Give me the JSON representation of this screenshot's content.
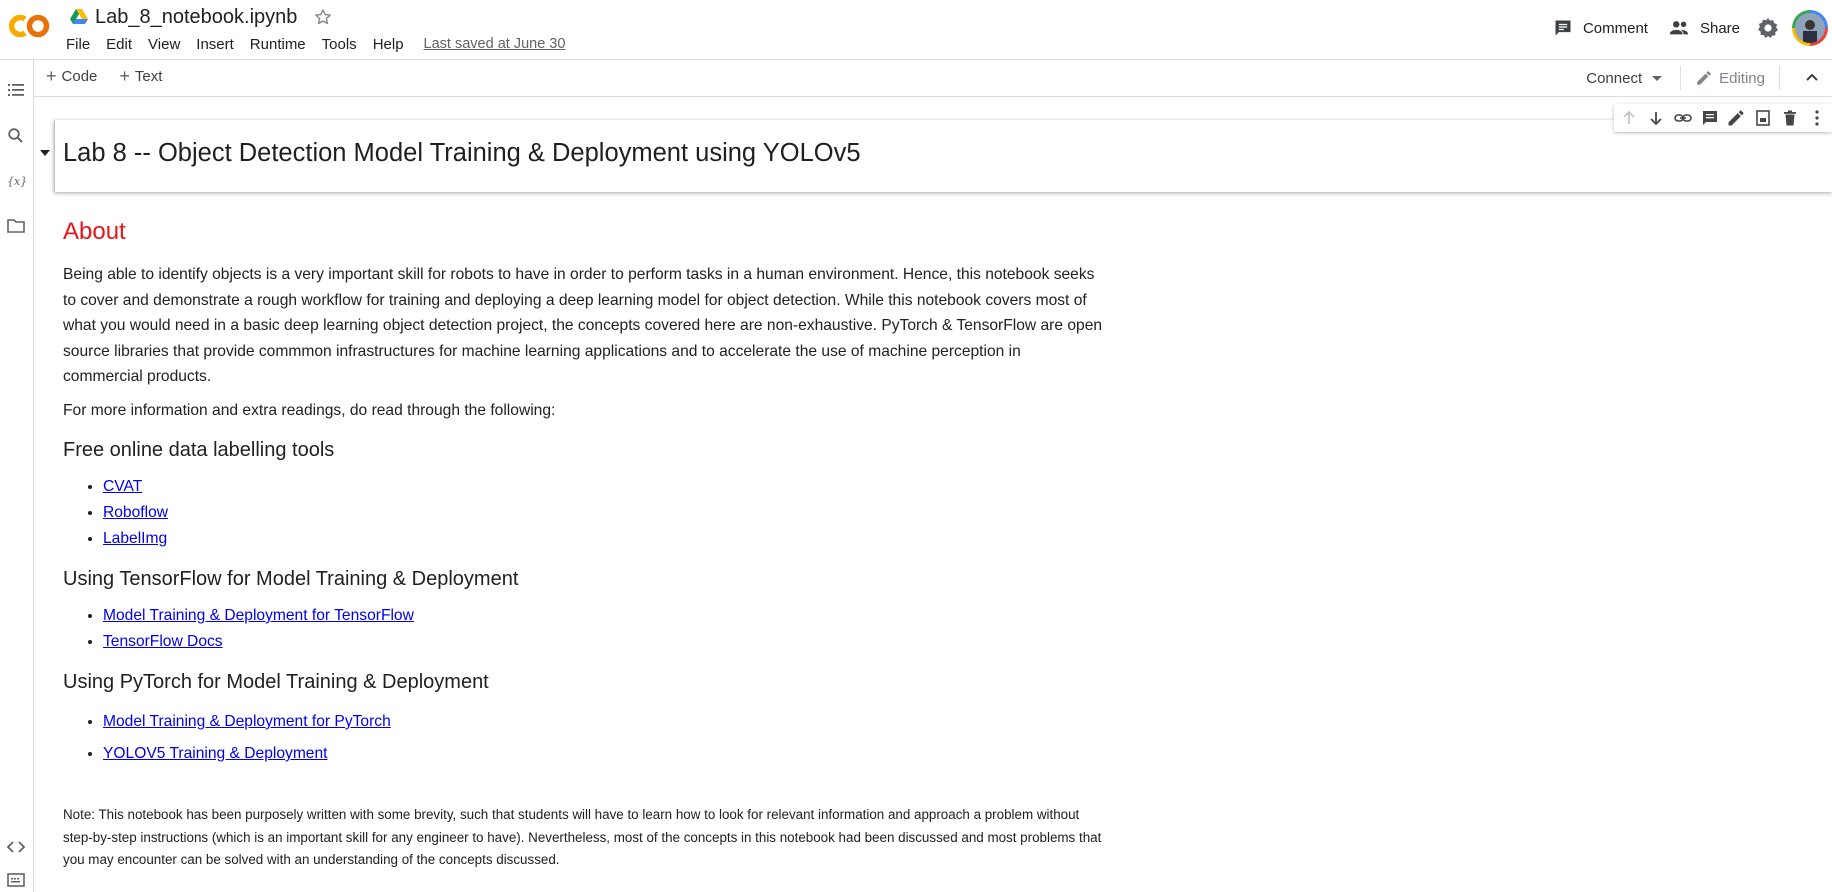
{
  "header": {
    "doc_title": "Lab_8_notebook.ipynb",
    "menu": [
      "File",
      "Edit",
      "View",
      "Insert",
      "Runtime",
      "Tools",
      "Help"
    ],
    "last_saved": "Last saved at June 30",
    "comment_label": "Comment",
    "share_label": "Share"
  },
  "toolbar": {
    "add_code": "Code",
    "add_text": "Text",
    "connect_label": "Connect",
    "editing_label": "Editing"
  },
  "cell": {
    "title": "Lab 8 -- Object Detection Model Training & Deployment using YOLOv5"
  },
  "content": {
    "about_heading": "About",
    "intro": "Being able to identify objects is a very important skill for robots to have in order to perform tasks in a human environment. Hence, this notebook seeks to cover and demonstrate a rough workflow for training and deploying a deep learning model for object detection. While this notebook covers most of what you would need in a basic deep learning object detection project, the concepts covered here are non-exhaustive. PyTorch & TensorFlow are open source libraries that provide commmon infrastructures for machine learning applications and to accelerate the use of machine perception in commercial products.",
    "more_info": "For more information and extra readings, do read through the following:",
    "sections": [
      {
        "heading": "Free online data labelling tools",
        "links": [
          "CVAT",
          "Roboflow",
          "LabelImg"
        ]
      },
      {
        "heading": "Using TensorFlow for Model Training & Deployment",
        "links": [
          "Model Training & Deployment for TensorFlow",
          "TensorFlow Docs"
        ]
      },
      {
        "heading": "Using PyTorch for Model Training & Deployment",
        "links": [
          "Model Training & Deployment for PyTorch",
          "YOLOV5 Training & Deployment"
        ]
      }
    ],
    "note": "Note: This notebook has been purposely written with some brevity, such that students will have to learn how to look for relevant information and approach a problem without step-by-step instructions (which is an important skill for any engineer to have). Nevertheless, most of the concepts in this notebook had been discussed and most problems that you may encounter can be solved with an understanding of the concepts discussed."
  },
  "colors": {
    "about_heading": "#e8141b",
    "link": "#0000ee",
    "logo_orange": "#f9ab00",
    "logo_dark_orange": "#e8710a"
  },
  "icons": {
    "left_rail": [
      "table-of-contents-icon",
      "search-icon",
      "variables-icon",
      "files-icon",
      "code-snippets-icon",
      "terminal-icon"
    ],
    "cell_toolbar": [
      "move-up-icon",
      "move-down-icon",
      "link-icon",
      "comment-icon",
      "edit-icon",
      "mirror-cell-icon",
      "delete-icon",
      "more-icon"
    ]
  }
}
